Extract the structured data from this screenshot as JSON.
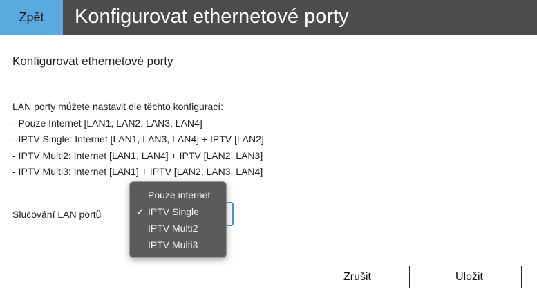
{
  "header": {
    "back_label": "Zpět",
    "title": "Konfigurovat ethernetové porty"
  },
  "section": {
    "title": "Konfigurovat ethernetové porty"
  },
  "description": {
    "lines": [
      "LAN porty můžete nastavit dle těchto konfigurací:",
      "- Pouze Internet [LAN1, LAN2, LAN3, LAN4]",
      "- IPTV Single: Internet [LAN1, LAN3, LAN4] + IPTV [LAN2]",
      "- IPTV Multi2: Internet [LAN1, LAN4] + IPTV [LAN2, LAN3]",
      "- IPTV Multi3: Internet [LAN1] + IPTV [LAN2, LAN3, LAN4]"
    ]
  },
  "field": {
    "label": "Slučování LAN portů",
    "selected": "IPTV Single",
    "options": [
      {
        "label": "Pouze internet",
        "checked": ""
      },
      {
        "label": "IPTV Single",
        "checked": "✓"
      },
      {
        "label": "IPTV Multi2",
        "checked": ""
      },
      {
        "label": "IPTV Multi3",
        "checked": ""
      }
    ]
  },
  "actions": {
    "cancel_label": "Zrušit",
    "save_label": "Uložit"
  },
  "colors": {
    "topbar": "#4c4c4c",
    "back_button": "#5aa9e0",
    "dropdown_bg": "#5b5b5b",
    "focus_border": "#4a90d9"
  }
}
